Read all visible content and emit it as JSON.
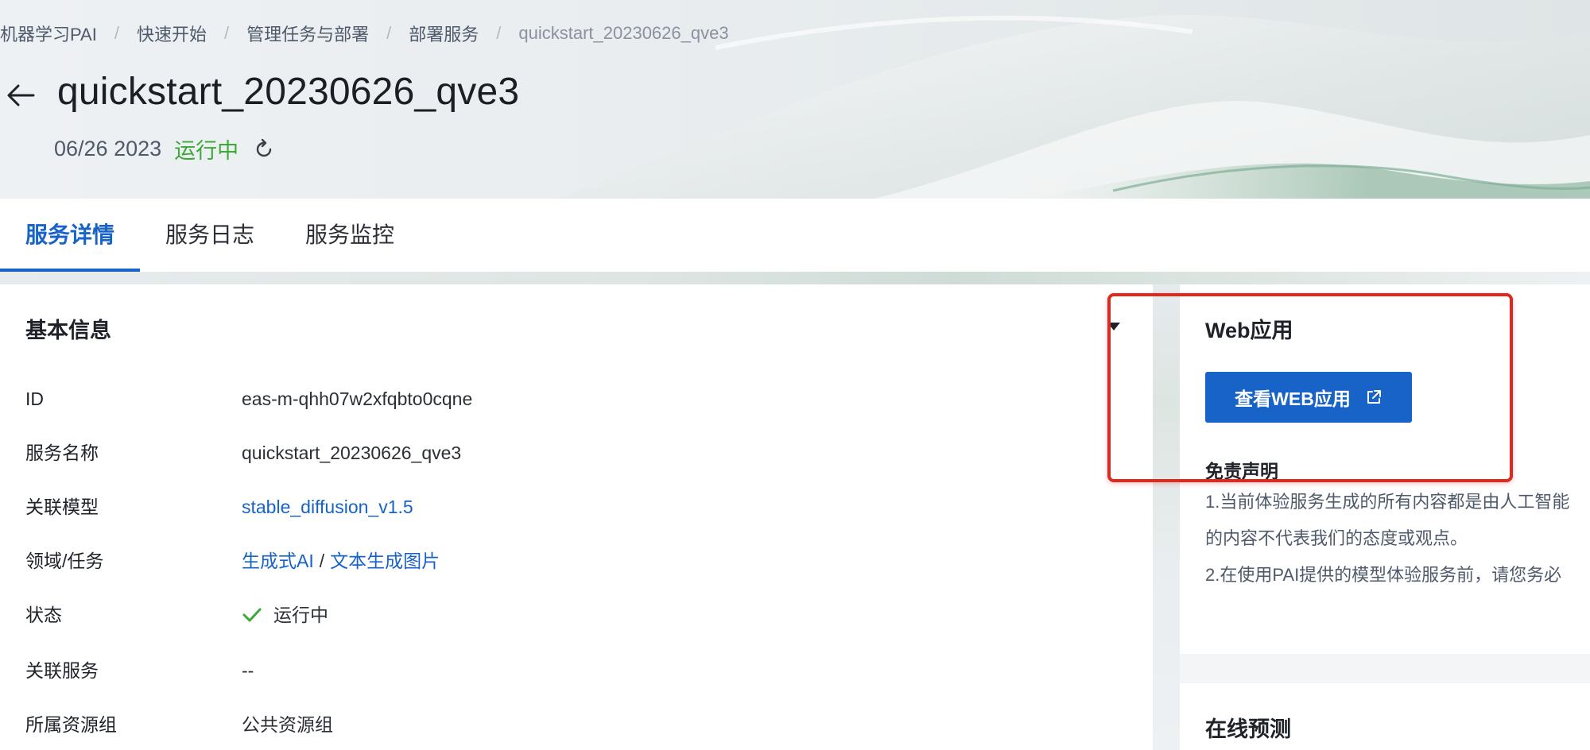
{
  "breadcrumb": {
    "items": [
      "机器学习PAI",
      "快速开始",
      "管理任务与部署",
      "部署服务",
      "quickstart_20230626_qve3"
    ],
    "separator": "/"
  },
  "header": {
    "title": "quickstart_20230626_qve3",
    "date": "06/26 2023",
    "status": "运行中",
    "status_color": "#3ba935"
  },
  "tabs": [
    "服务详情",
    "服务日志",
    "服务监控"
  ],
  "active_tab": "服务详情",
  "basic_info": {
    "title": "基本信息",
    "rows": {
      "id": {
        "label": "ID",
        "value": "eas-m-qhh07w2xfqbto0cqne"
      },
      "service_name": {
        "label": "服务名称",
        "value": "quickstart_20230626_qve3"
      },
      "model": {
        "label": "关联模型",
        "value": "stable_diffusion_v1.5"
      },
      "domain": {
        "label": "领域/任务",
        "domain_value": "生成式AI",
        "separator": "/",
        "task_value": "文本生成图片"
      },
      "status": {
        "label": "状态",
        "value": "运行中"
      },
      "related_service": {
        "label": "关联服务",
        "value": "--"
      },
      "resource_group": {
        "label": "所属资源组",
        "value": "公共资源组"
      }
    }
  },
  "web_app": {
    "title": "Web应用",
    "button_label": "查看WEB应用",
    "disclaimer_title": "免责声明",
    "disclaimer_lines": [
      "1.当前体验服务生成的所有内容都是由人工智能",
      "的内容不代表我们的态度或观点。",
      "2.在使用PAI提供的模型体验服务前，请您务必"
    ]
  },
  "online_predict": {
    "title": "在线预测"
  },
  "colors": {
    "accent": "#1763c8",
    "highlight": "#e0281f",
    "success": "#3ba935"
  },
  "icons": [
    "back-arrow-icon",
    "refresh-icon",
    "collapse-triangle-icon",
    "check-icon",
    "external-link-icon"
  ]
}
